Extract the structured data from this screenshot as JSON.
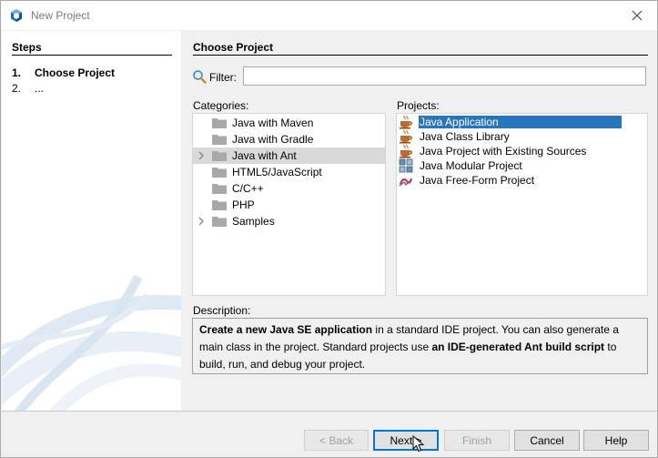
{
  "window": {
    "title": "New Project"
  },
  "steps": {
    "heading": "Steps",
    "items": [
      {
        "num": "1.",
        "label": "Choose Project"
      },
      {
        "num": "2.",
        "label": "..."
      }
    ]
  },
  "main": {
    "heading": "Choose Project",
    "filter": {
      "label": "Filter:",
      "value": ""
    },
    "categories": {
      "label": "Categories:",
      "items": [
        {
          "label": "Java with Maven",
          "expandable": false,
          "selected": false
        },
        {
          "label": "Java with Gradle",
          "expandable": false,
          "selected": false
        },
        {
          "label": "Java with Ant",
          "expandable": true,
          "selected": true
        },
        {
          "label": "HTML5/JavaScript",
          "expandable": false,
          "selected": false
        },
        {
          "label": "C/C++",
          "expandable": false,
          "selected": false
        },
        {
          "label": "PHP",
          "expandable": false,
          "selected": false
        },
        {
          "label": "Samples",
          "expandable": true,
          "selected": false
        }
      ]
    },
    "projects": {
      "label": "Projects:",
      "items": [
        {
          "label": "Java Application",
          "icon": "java-cup-icon",
          "selected": true
        },
        {
          "label": "Java Class Library",
          "icon": "java-cup-icon",
          "selected": false
        },
        {
          "label": "Java Project with Existing Sources",
          "icon": "java-cup-icon",
          "selected": false
        },
        {
          "label": "Java Modular Project",
          "icon": "modules-icon",
          "selected": false
        },
        {
          "label": "Java Free-Form Project",
          "icon": "freeform-icon",
          "selected": false
        }
      ]
    },
    "description": {
      "label": "Description:",
      "parts": [
        {
          "text": "Create a new Java SE application",
          "bold": true
        },
        {
          "text": " in a standard IDE project. You can also generate a main class in the project. Standard projects use ",
          "bold": false
        },
        {
          "text": "an IDE-generated Ant build script",
          "bold": true
        },
        {
          "text": " to build, run, and debug your project.",
          "bold": false
        }
      ]
    }
  },
  "buttons": {
    "back": "< Back",
    "next": "Next >",
    "finish": "Finish",
    "cancel": "Cancel",
    "help": "Help"
  },
  "colors": {
    "selection": "#2675bf",
    "category_selection": "#d9d9d9",
    "default_button_border": "#0078d7"
  }
}
